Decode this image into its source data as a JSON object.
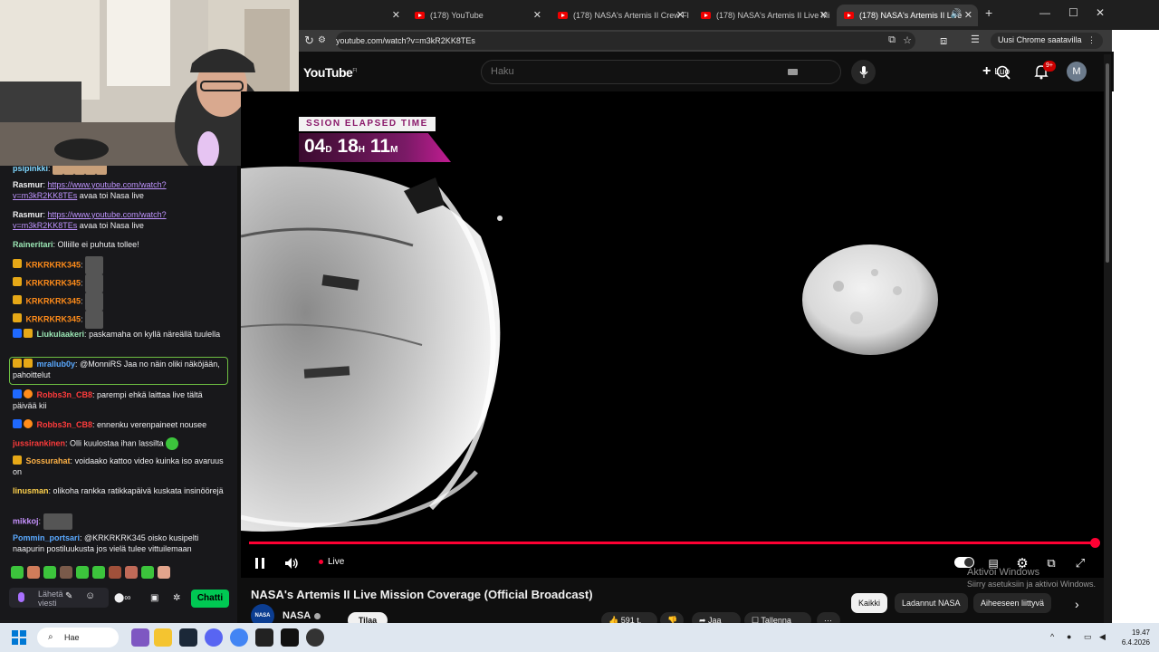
{
  "browser": {
    "tabs": [
      {
        "title": "(178) YouTube",
        "favicon": "youtube-icon"
      },
      {
        "title": "(178) NASA's Artemis II Crew Fl",
        "favicon": "youtube-icon"
      },
      {
        "title": "(178) NASA's Artemis II Live Mi",
        "favicon": "youtube-icon"
      },
      {
        "title": "(178) NASA's Artemis II Live",
        "favicon": "youtube-icon",
        "active": true,
        "audio": true
      }
    ],
    "new_tab": "+",
    "url": "youtube.com/watch?v=m3kR2KK8TEs",
    "chrome_update": "Uusi Chrome saatavilla",
    "profile_initial": "M"
  },
  "youtube": {
    "logo": "YouTube",
    "region": "FI",
    "search_placeholder": "Haku",
    "create_label": "Luo",
    "notifications": "9+",
    "avatar_initial": "M"
  },
  "video": {
    "overlay": {
      "label": "SSION ELAPSED TIME",
      "days": "04",
      "hours": "18",
      "minutes": "11",
      "d": "D",
      "h": "H",
      "m": "M"
    },
    "live_label": "Live",
    "progress": 1.0,
    "title": "NASA's Artemis II Live Mission Coverage (Official Broadcast)",
    "channel": "NASA",
    "channel_logo": "NASA",
    "subscribe": "Tilaa",
    "likes": "591 t.",
    "share": "Jaa",
    "save": "Tallenna",
    "chips": [
      "Kaikki",
      "Ladannut NASA",
      "Aiheeseen liittyvä"
    ]
  },
  "watermark": {
    "title": "Aktivoi Windows",
    "subtitle": "Siirry asetuksiin ja aktivoi Windows."
  },
  "chat": {
    "messages": [
      {
        "user": "psipinkki",
        "color": "#7fd7ff",
        "text": ""
      },
      {
        "user": "Rasmur",
        "color": "#efeff1",
        "link": "https://www.youtube.com/watch?v=m3kR2KK8TEs",
        "text": " avaa toi Nasa live"
      },
      {
        "user": "Rasmur",
        "color": "#efeff1",
        "link": "https://www.youtube.com/watch?v=m3kR2KK8TEs",
        "text": " avaa toi Nasa live"
      },
      {
        "user": "Raineritari",
        "color": "#9ae6b4",
        "text": "Olliille ei puhuta tollee!"
      },
      {
        "user": "KRKRKRK345",
        "color": "#ff8c1a",
        "text": ""
      },
      {
        "user": "KRKRKRK345",
        "color": "#ff8c1a",
        "text": ""
      },
      {
        "user": "KRKRKRK345",
        "color": "#ff8c1a",
        "text": ""
      },
      {
        "user": "KRKRKRK345",
        "color": "#ff8c1a",
        "text": ""
      },
      {
        "user": "Liukulaakeri",
        "color": "#9ae6b4",
        "text": "paskamaha on kyllä näreällä tuulella"
      },
      {
        "user": "mrallub0y",
        "color": "#5aa9ff",
        "text": "@MonniRS Jaa no näin oliki näköjään, pahoittelut"
      },
      {
        "user": "Robbs3n_CB8",
        "color": "#ff3b3b",
        "text": "parempi ehkä laittaa live tältä päivää kii"
      },
      {
        "user": "Robbs3n_CB8",
        "color": "#ff3b3b",
        "text": "ennenku verenpaineet nousee"
      },
      {
        "user": "jussirankinen",
        "color": "#ff3b3b",
        "text": "Olli kuulostaa ihan lassilta"
      },
      {
        "user": "Sossurahat",
        "color": "#ffb347",
        "text": "voidaako kattoo video kuinka iso avaruus on"
      },
      {
        "user": "linusman",
        "color": "#ffd24d",
        "text": "olikoha rankka ratikkapäivä kuskata insinöörejä"
      },
      {
        "user": "mikkoj",
        "color": "#c792ff",
        "text": ""
      },
      {
        "user": "Pommin_portsari",
        "color": "#5aa9ff",
        "text": "@KRKRKRK345 oisko kusipelti naapurin postiluukusta jos vielä tulee vittuilemaan"
      }
    ],
    "input_placeholder": "Lähetä viesti",
    "send_label": "Chatti"
  },
  "taskbar": {
    "search": "Hae",
    "time": "19.47",
    "date": "6.4.2026"
  }
}
